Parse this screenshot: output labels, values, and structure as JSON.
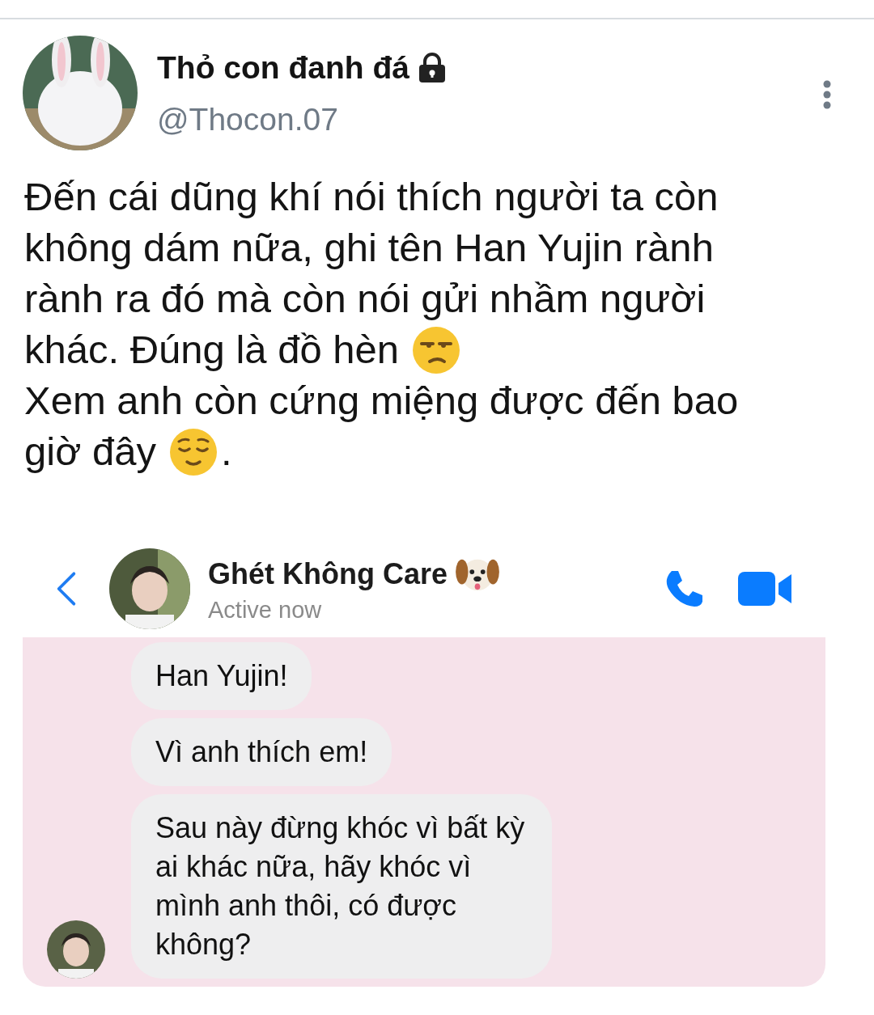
{
  "tweet": {
    "author": {
      "name": "Thỏ con đanh đá",
      "protected": true,
      "handle": "@Thocon.07"
    },
    "lines": [
      {
        "text": "Đến cái dũng khí nói thích người ta còn"
      },
      {
        "text": "không dám nữa, ghi tên Han Yujin rành"
      },
      {
        "text": "rành ra đó mà còn nói gửi nhầm người"
      },
      {
        "text": "khác. Đúng là đồ hèn",
        "icon": {
          "kind": "unamused_face"
        }
      },
      {
        "text": "Xem anh còn cứng miệng được đến bao"
      },
      {
        "text": "giờ đây",
        "icon": {
          "kind": "relieved_face"
        },
        "after": "."
      }
    ]
  },
  "chat": {
    "contact": {
      "name": "Ghét Không Care",
      "icon": {
        "kind": "dog_face"
      },
      "status": "Active now"
    },
    "messages": [
      {
        "text": "Han Yujin!"
      },
      {
        "text": "Vì anh thích em!"
      },
      {
        "text": "Sau này đừng khóc vì bất kỳ ai khác nữa, hãy khóc vì mình anh thôi, có được không?"
      }
    ]
  }
}
